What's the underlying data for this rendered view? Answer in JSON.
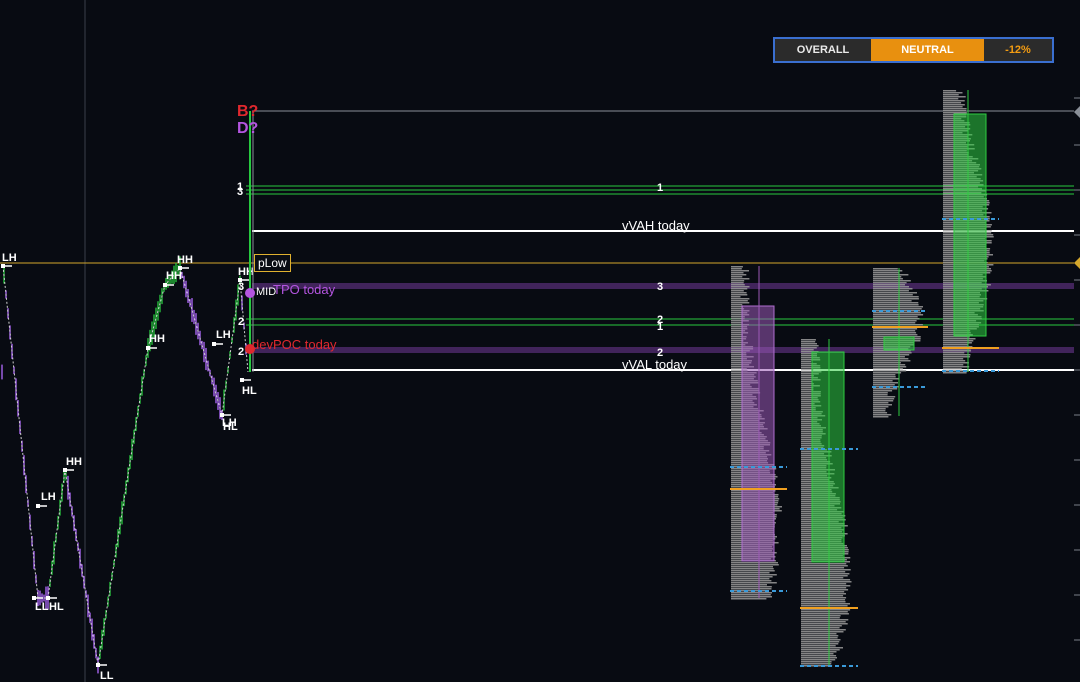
{
  "status_panel": {
    "overall_label": "OVERALL",
    "state_label": "NEUTRAL",
    "change_label": "-12%"
  },
  "chart_data": {
    "type": "line",
    "title": "",
    "xlabel": "",
    "ylabel": "",
    "level_labels": {
      "vvah": "vVAH today",
      "vval": "vVAL today",
      "plow": "pLow",
      "tpo": "TPO today",
      "devpoc": "devPOC today",
      "mid": "MID",
      "b_marker": "B?",
      "d_marker": "D?"
    },
    "count_labels": [
      "1",
      "3",
      "3",
      "2",
      "1",
      "2",
      "3",
      "2",
      "2",
      "1",
      "2"
    ],
    "swing_labels": [
      "LH",
      "HH",
      "HH",
      "HH",
      "HH",
      "LH",
      "HH",
      "LH",
      "LL",
      "LH",
      "HL",
      "LL",
      "HL",
      "HL"
    ],
    "colors": {
      "up_candle": "#27c93f",
      "down_candle": "#b36bff",
      "profile_gray": "#9b9b9b",
      "value_area_green": "#2ecc40",
      "value_area_purple": "#9b59b6",
      "poc_orange": "#f0a020",
      "plow_line": "#d4a72c",
      "vah_val_line": "#ffffff"
    }
  }
}
